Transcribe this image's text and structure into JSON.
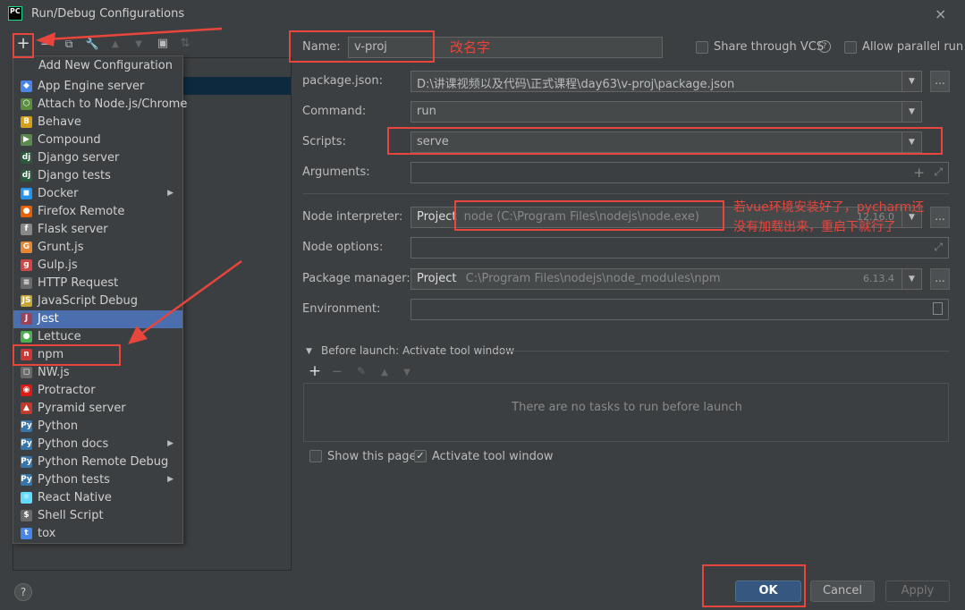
{
  "window": {
    "title": "Run/Debug Configurations",
    "app_icon": "PC",
    "close_glyph": "×"
  },
  "toolbar": {
    "add": "+",
    "remove": "−",
    "copy": "⧉",
    "edit": "🔧",
    "up": "▲",
    "down": "▼",
    "folder": "▣",
    "sort": "⇅"
  },
  "popup": {
    "header": "Add New Configuration",
    "items": [
      {
        "label": "App Engine server",
        "icon": "app-engine-icon",
        "color": "#4a86e8",
        "glyph": "◆"
      },
      {
        "label": "Attach to Node.js/Chrome",
        "icon": "node-icon",
        "color": "#5a8f3e",
        "glyph": "⬡"
      },
      {
        "label": "Behave",
        "icon": "behave-icon",
        "color": "#d4a017",
        "glyph": "B"
      },
      {
        "label": "Compound",
        "icon": "compound-icon",
        "color": "#5b8a4f",
        "glyph": "▶"
      },
      {
        "label": "Django server",
        "icon": "django-icon",
        "color": "#2b5b3c",
        "glyph": "dj"
      },
      {
        "label": "Django tests",
        "icon": "django-icon",
        "color": "#2b5b3c",
        "glyph": "dj"
      },
      {
        "label": "Docker",
        "icon": "docker-icon",
        "color": "#2496ed",
        "glyph": "◼",
        "submenu": true
      },
      {
        "label": "Firefox Remote",
        "icon": "firefox-icon",
        "color": "#e66000",
        "glyph": "●"
      },
      {
        "label": "Flask server",
        "icon": "flask-icon",
        "color": "#888888",
        "glyph": "f"
      },
      {
        "label": "Grunt.js",
        "icon": "grunt-icon",
        "color": "#e48632",
        "glyph": "G"
      },
      {
        "label": "Gulp.js",
        "icon": "gulp-icon",
        "color": "#cf4647",
        "glyph": "g"
      },
      {
        "label": "HTTP Request",
        "icon": "http-icon",
        "color": "#6a6a6a",
        "glyph": "≡"
      },
      {
        "label": "JavaScript Debug",
        "icon": "js-debug-icon",
        "color": "#c9a632",
        "glyph": "JS"
      },
      {
        "label": "Jest",
        "icon": "jest-icon",
        "color": "#99425b",
        "glyph": "J",
        "selected": true
      },
      {
        "label": "Lettuce",
        "icon": "lettuce-icon",
        "color": "#4caf50",
        "glyph": "●"
      },
      {
        "label": "npm",
        "icon": "npm-icon",
        "color": "#cb3837",
        "glyph": "n"
      },
      {
        "label": "NW.js",
        "icon": "nwjs-icon",
        "color": "#6a6a6a",
        "glyph": "◻"
      },
      {
        "label": "Protractor",
        "icon": "protractor-icon",
        "color": "#dd1b16",
        "glyph": "◉"
      },
      {
        "label": "Pyramid server",
        "icon": "pyramid-icon",
        "color": "#c0392b",
        "glyph": "▲"
      },
      {
        "label": "Python",
        "icon": "python-icon",
        "color": "#3776ab",
        "glyph": "Py"
      },
      {
        "label": "Python docs",
        "icon": "python-docs-icon",
        "color": "#3776ab",
        "glyph": "Py",
        "submenu": true
      },
      {
        "label": "Python Remote Debug",
        "icon": "python-remote-icon",
        "color": "#3776ab",
        "glyph": "Py"
      },
      {
        "label": "Python tests",
        "icon": "python-tests-icon",
        "color": "#3776ab",
        "glyph": "Py",
        "submenu": true
      },
      {
        "label": "React Native",
        "icon": "react-icon",
        "color": "#61dafb",
        "glyph": "⚛"
      },
      {
        "label": "Shell Script",
        "icon": "shell-icon",
        "color": "#6a6a6a",
        "glyph": "$"
      },
      {
        "label": "tox",
        "icon": "tox-icon",
        "color": "#4a86e8",
        "glyph": "t"
      }
    ]
  },
  "form": {
    "name_label": "Name:",
    "name_value": "v-proj",
    "share_vcs": "Share through VCS",
    "allow_parallel": "Allow parallel run",
    "package_json_label": "package.json:",
    "package_json_value": "D:\\讲课视频以及代码\\正式课程\\day63\\v-proj\\package.json",
    "command_label": "Command:",
    "command_value": "run",
    "scripts_label": "Scripts:",
    "scripts_value": "serve",
    "arguments_label": "Arguments:",
    "node_interpreter_label": "Node interpreter:",
    "node_interpreter_prefix": "Project",
    "node_interpreter_value": "node (C:\\Program Files\\nodejs\\node.exe)",
    "node_version": "12.16.0",
    "node_options_label": "Node options:",
    "package_manager_label": "Package manager:",
    "package_manager_prefix": "Project",
    "package_manager_value": "C:\\Program Files\\nodejs\\node_modules\\npm",
    "package_manager_version": "6.13.4",
    "environment_label": "Environment:",
    "before_launch": "Before launch: Activate tool window",
    "no_tasks": "There are no tasks to run before launch",
    "show_page": "Show this page",
    "activate_tool_window": "Activate tool window",
    "ellipsis": "...",
    "expand_glyph": "⤢",
    "plus_glyph": "+"
  },
  "buttons": {
    "ok": "OK",
    "cancel": "Cancel",
    "apply": "Apply",
    "help": "?"
  },
  "annotations": {
    "rename": "改名字",
    "pycharm_note_line1": "若vue环境安装好了，pycharm还",
    "pycharm_note_line2": "没有加载出来，重启下就行了"
  },
  "colors": {
    "annotation_red": "#e8453c",
    "selection_blue": "#4b6eaf",
    "primary_button": "#365880"
  }
}
